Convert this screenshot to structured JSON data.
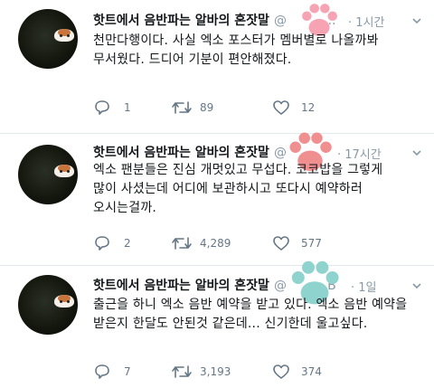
{
  "tweets": [
    {
      "author_name": "핫트에서 음반파는 알바의 혼잣말",
      "handle": "@",
      "handle_tail": "...",
      "time": "· 1시간",
      "text_lines": [
        "천만다행이다. 사실 엑소 포스터가 멤버별로 나올까봐",
        "무서웠다. 드디어 기분이 편안해졌다."
      ],
      "replies": "1",
      "retweets": "89",
      "likes": "12",
      "paw_color": "#f6a3b4"
    },
    {
      "author_name": "핫트에서 음반파는 알바의 혼잣말",
      "handle": "@",
      "handle_tail": "",
      "time": "· 17시간",
      "text_lines": [
        "엑소 팬분들은 진심 개멋있고 무섭다. 코코밥을 그렇게",
        "많이 사셨는데 어디에 보관하시고 또다시 예약하러",
        "오시는걸까."
      ],
      "replies": "2",
      "retweets": "4,289",
      "likes": "577",
      "paw_color": "#f08f8f"
    },
    {
      "author_name": "핫트에서 음반파는 알바의 혼잣말",
      "handle": "@",
      "handle_tail": "B",
      "time": "· 1일",
      "text_lines": [
        "출근을 하니 엑소 음반 예약을 받고 있다. 엑소 음반 예약을",
        "받은지 한달도 안된것 같은데... 신기한데 울고싶다."
      ],
      "replies": "7",
      "retweets": "3,193",
      "likes": "374",
      "paw_color": "#8fd3cf"
    }
  ],
  "icons": {
    "reply": "reply-icon",
    "retweet": "retweet-icon",
    "like": "heart-icon",
    "more": "chevron-down-icon",
    "sticker": "paw-print-sticker"
  }
}
